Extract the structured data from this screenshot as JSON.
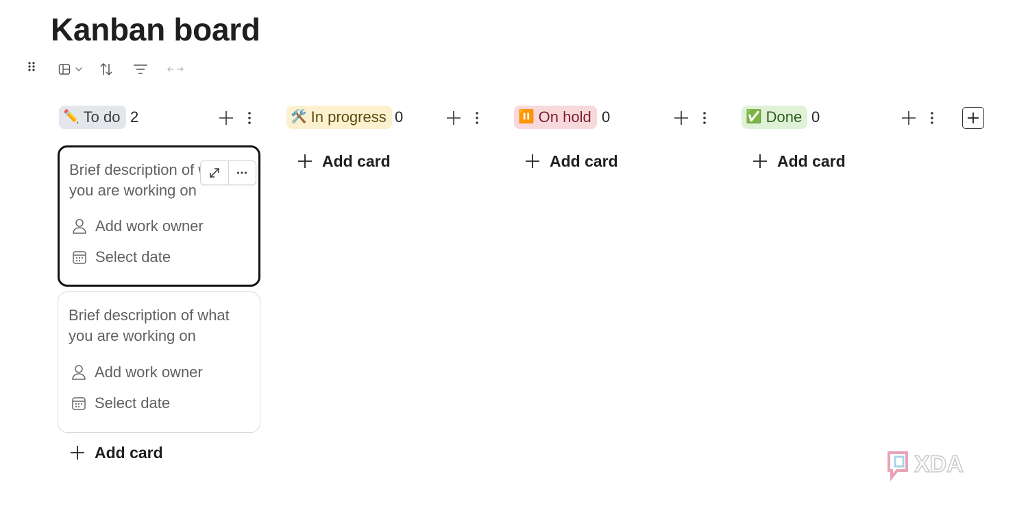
{
  "page": {
    "title": "Kanban board"
  },
  "toolbar": {
    "icons": [
      "drag-handle-icon",
      "board-view-icon",
      "chevron-down-icon",
      "sort-icon",
      "filter-icon",
      "expand-width-icon"
    ]
  },
  "columns": [
    {
      "label": "To do",
      "emoji": "✏️",
      "count": "2",
      "pill_bg": "#e3e7ec",
      "pill_fg": "#3a3a3a"
    },
    {
      "label": "In progress",
      "emoji": "🛠️",
      "count": "0",
      "pill_bg": "#fbf1cf",
      "pill_fg": "#5c4a12"
    },
    {
      "label": "On hold",
      "emoji": "⏸️",
      "count": "0",
      "pill_bg": "#f7d9dc",
      "pill_fg": "#7a1f2b"
    },
    {
      "label": "Done",
      "emoji": "✅",
      "count": "0",
      "pill_bg": "#dff2d8",
      "pill_fg": "#2e5e1e"
    }
  ],
  "cards": [
    {
      "description": "Brief description of what you are working on",
      "owner": "Add work owner",
      "date": "Select date"
    },
    {
      "description": "Brief description of what you are working on",
      "owner": "Add work owner",
      "date": "Select date"
    }
  ],
  "add_card_label": "Add card",
  "watermark": {
    "text": "XDA"
  }
}
